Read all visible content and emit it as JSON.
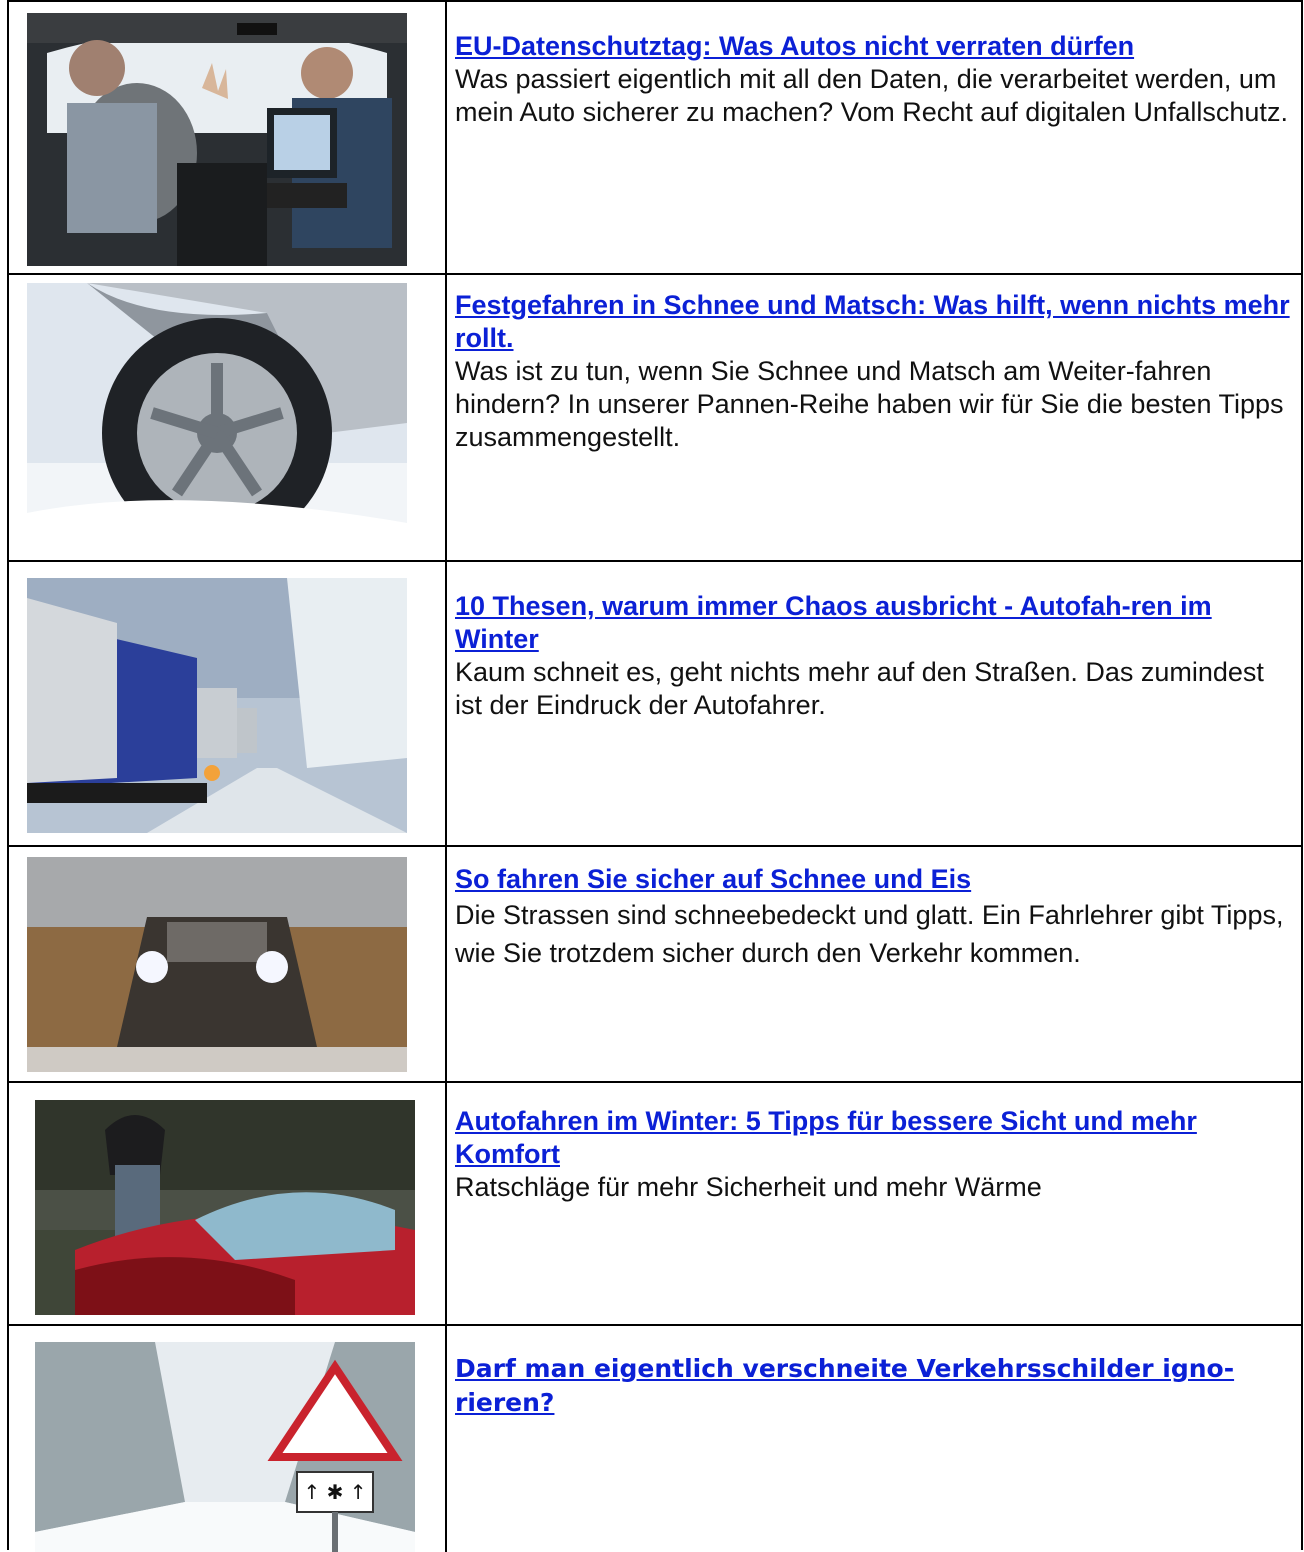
{
  "articles": [
    {
      "title": "EU-Datenschutztag: Was Autos nicht verraten dürfen",
      "description": "Was passiert eigentlich mit all den Daten, die verarbeitet werden, um mein Auto sicherer zu machen? Vom Recht auf digitalen Unfallschutz.",
      "image": "car-interior-testing-photo"
    },
    {
      "title": "Festgefahren in Schnee und Matsch: Was hilft, wenn nichts mehr rollt.",
      "description": "Was ist zu tun, wenn Sie Schnee und Matsch am Weiter-fahren hindern? In unserer Pannen-Reihe haben wir für Sie die besten Tipps zusammengestellt.",
      "image": "tire-in-snow-photo"
    },
    {
      "title": "10 Thesen, warum immer Chaos ausbricht - Autofah-ren im Winter",
      "description": "Kaum schneit es, geht nichts mehr auf den Straßen. Das zumindest ist der Eindruck der Autofahrer.",
      "image": "trucks-snowy-highway-photo"
    },
    {
      "title": "So fahren Sie sicher auf Schnee und Eis",
      "description": "Die Strassen sind schneebedeckt und glatt. Ein Fahrlehrer gibt Tipps, wie Sie trotzdem sicher durch den Verkehr kommen.",
      "image": "car-headlights-snowstorm-photo"
    },
    {
      "title": "Autofahren im Winter: 5 Tipps für bessere Sicht und mehr Komfort",
      "description": "Ratschläge für mehr Sicherheit und mehr Wärme",
      "image": "woman-frozen-red-car-photo"
    },
    {
      "title": "Darf man eigentlich verschneite Verkehrsschilder igno-rieren?",
      "description": "",
      "image": "snowy-warning-sign-photo"
    }
  ],
  "colors": {
    "link": "#0b20d6",
    "text": "#111111",
    "border": "#000000"
  }
}
